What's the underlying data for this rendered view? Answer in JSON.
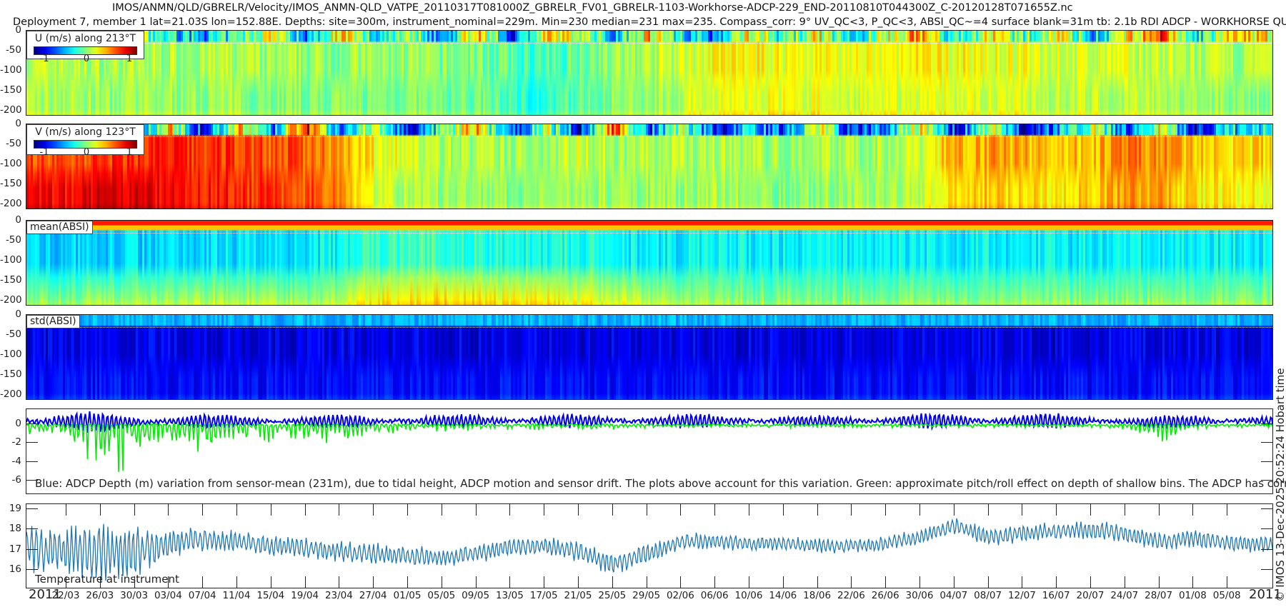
{
  "title": {
    "line1": "IMOS/ANMN/QLD/GBRELR/Velocity/IMOS_ANMN-QLD_VATPE_20110317T081000Z_GBRELR_FV01_GBRELR-1103-Workhorse-ADCP-229_END-20110810T044300Z_C-20120128T071655Z.nc",
    "line2": "Deployment 7, member 1 lat=21.03S lon=152.88E. Depths: site=300m, instrument_nominal=229m. Min=230 median=231 max=235. Compass_corr: 9° UV_QC<3, P_QC<3, ABSI_QC~=4 surface blank=31m tb: 2.1b RDI ADCP - WORKHORSE QUARTERMASTER"
  },
  "x_axis": {
    "year_left": "2011",
    "year_right": "2011",
    "ticks": [
      "22/03",
      "26/03",
      "30/03",
      "03/04",
      "07/04",
      "11/04",
      "15/04",
      "19/04",
      "23/04",
      "27/04",
      "01/05",
      "05/05",
      "09/05",
      "13/05",
      "17/05",
      "21/05",
      "25/05",
      "29/05",
      "02/06",
      "06/06",
      "10/06",
      "14/06",
      "18/06",
      "22/06",
      "26/06",
      "30/06",
      "04/07",
      "08/07",
      "12/07",
      "16/07",
      "20/07",
      "24/07",
      "28/07",
      "01/08",
      "05/08"
    ]
  },
  "footer": "© IMOS 13-Dec-2025 20:52:24 Hobart time",
  "colors": {
    "depth_series": "#0000ee",
    "pitch_roll_series": "#00ee00",
    "temperature_series": "#1f77b4",
    "colormap": "jet"
  },
  "chart_data": [
    {
      "type": "heatmap",
      "id": "u",
      "legend": "U (m/s) along 213°T",
      "colorbar_ticks": [
        "-1",
        "0",
        "1"
      ],
      "clim": [
        -1.25,
        1.25
      ],
      "ylim": [
        -214,
        0
      ],
      "ytick_labels": [
        "0",
        "-50",
        "-100",
        "-150",
        "-200"
      ],
      "surface_blank_depth": -30,
      "band_values_by_tick_date": {
        "surface": [
          0.3,
          0.2,
          0,
          -0.3,
          -0.5,
          -0.2,
          0.4,
          -0.6,
          0.5,
          -0.4,
          0.2,
          -0.7,
          0.6,
          -0.8,
          0.3,
          0.2,
          -0.5,
          0.5,
          -0.3,
          -0.6,
          0.4,
          -0.3,
          0.3,
          -0.5,
          0.2,
          0.6,
          -0.4,
          0.3,
          -0.2,
          0.4,
          -0.5,
          0.2,
          0.8,
          -0.4,
          0.3
        ],
        "upper": [
          0.15,
          0.1,
          0.1,
          0.1,
          0.1,
          0.1,
          0.05,
          0.05,
          0.05,
          0.05,
          0.05,
          0,
          0,
          -0.1,
          -0.2,
          0,
          0.05,
          0.1,
          0.2,
          0.3,
          0.3,
          0.3,
          0.3,
          0.25,
          0.25,
          0.3,
          0.3,
          0.25,
          0.25,
          0.2,
          0.2,
          0.2,
          0.15,
          0.1,
          0.1
        ],
        "lower": [
          0.1,
          0.05,
          0.05,
          0.05,
          0.05,
          0.05,
          0,
          0,
          0,
          0,
          0,
          -0.05,
          -0.05,
          -0.15,
          -0.25,
          -0.05,
          0,
          0.05,
          0.15,
          0.25,
          0.25,
          0.25,
          0.25,
          0.2,
          0.2,
          0.25,
          0.25,
          0.2,
          0.2,
          0.15,
          0.15,
          0.15,
          0.1,
          0.05,
          0.05
        ]
      }
    },
    {
      "type": "heatmap",
      "id": "v",
      "legend": "V (m/s) along 123°T",
      "colorbar_ticks": [
        "-1",
        "0",
        "1"
      ],
      "clim": [
        -1.25,
        1.25
      ],
      "ylim": [
        -214,
        0
      ],
      "ytick_labels": [
        "0",
        "-50",
        "-100",
        "-150",
        "-200"
      ],
      "surface_blank_depth": -30,
      "band_values_by_tick_date": {
        "surface": [
          -0.8,
          0.3,
          -0.9,
          0.4,
          -1,
          0.5,
          -0.7,
          1.1,
          -0.9,
          0.3,
          -1,
          -0.2,
          0.5,
          -0.9,
          0.2,
          -1,
          0.9,
          -0.8,
          0.2,
          -1,
          -0.3,
          -0.9,
          0.4,
          -1,
          -0.5,
          0.3,
          -0.9,
          0.2,
          -1,
          -0.6,
          0.2,
          -0.8,
          0.3,
          -1,
          -0.4
        ],
        "upper": [
          0.75,
          0.8,
          0.85,
          0.85,
          0.8,
          0.8,
          0.75,
          0.7,
          0.6,
          0.3,
          0.2,
          0.1,
          0.1,
          0.05,
          0.1,
          0.2,
          0.1,
          0.1,
          0.1,
          0.15,
          0.1,
          0.05,
          0.1,
          0.1,
          0.1,
          0.2,
          0.5,
          0.55,
          0.5,
          0.45,
          0.5,
          0.6,
          0.6,
          0.45,
          0.4
        ],
        "lower": [
          0.95,
          1.0,
          1.0,
          0.95,
          0.9,
          0.85,
          0.8,
          0.75,
          0.65,
          0.2,
          0.1,
          0.05,
          0.05,
          0,
          0.05,
          0.1,
          0.05,
          0.05,
          0.05,
          0.1,
          0.05,
          0,
          0.05,
          0.05,
          0.1,
          0.15,
          0.4,
          0.45,
          0.4,
          0.35,
          0.45,
          0.55,
          0.55,
          0.35,
          0.3
        ]
      }
    },
    {
      "type": "heatmap",
      "id": "mean_absi",
      "legend": "mean(ABSI)",
      "ylim": [
        -214,
        0
      ],
      "ytick_labels": [
        "0",
        "-50",
        "-100",
        "-150",
        "-200"
      ],
      "band_levels_by_tick_date": {
        "surface": [
          0.85,
          0.85,
          0.85,
          0.85,
          0.85,
          0.85,
          0.85,
          0.85,
          0.85,
          0.85,
          0.85,
          0.85,
          0.85,
          0.85,
          0.85,
          0.85,
          0.85,
          0.85,
          0.85,
          0.85,
          0.85,
          0.85,
          0.85,
          0.85,
          0.85,
          0.85,
          0.85,
          0.85,
          0.85,
          0.85,
          0.85,
          0.85,
          0.85,
          0.85,
          0.85
        ],
        "upper": [
          0.33,
          0.33,
          0.34,
          0.34,
          0.35,
          0.35,
          0.35,
          0.36,
          0.38,
          0.42,
          0.44,
          0.44,
          0.42,
          0.4,
          0.4,
          0.4,
          0.38,
          0.36,
          0.36,
          0.37,
          0.37,
          0.37,
          0.37,
          0.37,
          0.37,
          0.37,
          0.37,
          0.37,
          0.37,
          0.37,
          0.37,
          0.37,
          0.37,
          0.37,
          0.37
        ],
        "lower": [
          0.5,
          0.52,
          0.52,
          0.53,
          0.53,
          0.53,
          0.52,
          0.52,
          0.55,
          0.62,
          0.64,
          0.65,
          0.64,
          0.62,
          0.62,
          0.6,
          0.58,
          0.55,
          0.52,
          0.52,
          0.5,
          0.5,
          0.5,
          0.5,
          0.5,
          0.5,
          0.5,
          0.5,
          0.5,
          0.5,
          0.5,
          0.5,
          0.5,
          0.5,
          0.5
        ]
      }
    },
    {
      "type": "heatmap",
      "id": "std_absi",
      "legend": "std(ABSI)",
      "ylim": [
        -214,
        0
      ],
      "ytick_labels": [
        "0",
        "-50",
        "-100",
        "-150",
        "-200"
      ],
      "band_levels_by_tick_date": {
        "surface": [
          0.3,
          0.3,
          0.3,
          0.3,
          0.3,
          0.3,
          0.3,
          0.3,
          0.3,
          0.3,
          0.3,
          0.3,
          0.3,
          0.3,
          0.3,
          0.3,
          0.3,
          0.3,
          0.3,
          0.3,
          0.3,
          0.3,
          0.3,
          0.3,
          0.3,
          0.3,
          0.3,
          0.3,
          0.3,
          0.3,
          0.3,
          0.3,
          0.3,
          0.3,
          0.3
        ],
        "upper": [
          0.1,
          0.1,
          0.1,
          0.1,
          0.1,
          0.1,
          0.1,
          0.1,
          0.1,
          0.1,
          0.1,
          0.1,
          0.1,
          0.1,
          0.1,
          0.1,
          0.1,
          0.1,
          0.1,
          0.1,
          0.1,
          0.1,
          0.1,
          0.1,
          0.1,
          0.1,
          0.1,
          0.1,
          0.1,
          0.1,
          0.1,
          0.1,
          0.1,
          0.1,
          0.1
        ],
        "lower": [
          0.13,
          0.13,
          0.13,
          0.13,
          0.13,
          0.13,
          0.13,
          0.13,
          0.13,
          0.13,
          0.13,
          0.13,
          0.13,
          0.13,
          0.13,
          0.13,
          0.13,
          0.13,
          0.13,
          0.13,
          0.13,
          0.13,
          0.13,
          0.13,
          0.13,
          0.13,
          0.13,
          0.13,
          0.13,
          0.13,
          0.13,
          0.13,
          0.13,
          0.13,
          0.13
        ]
      }
    },
    {
      "type": "line",
      "id": "depth",
      "note": "Blue: ADCP Depth (m) variation from sensor-mean (231m), due to tidal height, ADCP motion and sensor drift. The plots above account for this variation. Green: approximate pitch/roll effect on depth of shallow bins. The ADCP has corrected for this.",
      "ylim": [
        -7.5,
        1.6
      ],
      "ytick_labels": [
        "0",
        "-2",
        "-4",
        "-6"
      ],
      "yticks": [
        0,
        -2,
        -4,
        -6
      ],
      "blue_mean_by_tick_date": [
        0.3,
        0.2,
        0.2,
        0.3,
        0.3,
        0.3,
        0.3,
        0.3,
        0.3,
        0.3,
        0.35,
        0.35,
        0.35,
        0.35,
        0.35,
        0.35,
        0.35,
        0.35,
        0.35,
        0.35,
        0.35,
        0.35,
        0.35,
        0.35,
        0.35,
        0.35,
        0.35,
        0.35,
        0.35,
        0.35,
        0.35,
        0.3,
        0.2,
        0.3,
        0.35
      ],
      "blue_tidal_amplitude_by_tick_date": [
        1.2,
        1.0,
        0.9,
        0.8,
        0.7,
        0.6,
        0.6,
        0.6,
        0.7,
        0.7,
        0.6,
        0.6,
        0.7,
        0.8,
        0.7,
        0.6,
        0.6,
        0.6,
        0.7,
        0.7,
        0.6,
        0.5,
        0.5,
        0.6,
        0.6,
        0.7,
        0.8,
        0.8,
        0.8,
        0.7,
        0.6,
        0.6,
        0.7,
        0.7,
        0.6
      ],
      "green_min_by_tick_date": [
        -2,
        -5.5,
        -5,
        -4.5,
        -3,
        -2,
        -2,
        -1.5,
        -2.5,
        -1,
        -0.8,
        -0.8,
        -0.6,
        -0.5,
        -0.5,
        -0.5,
        -0.6,
        -0.3,
        -0.3,
        -0.3,
        -0.3,
        -0.3,
        -0.3,
        -0.3,
        -0.3,
        -0.3,
        -0.3,
        -0.3,
        -0.3,
        -0.3,
        -0.3,
        -0.5,
        -2,
        -0.6,
        -0.3
      ]
    },
    {
      "type": "line",
      "id": "temperature",
      "label": "Temperature at instrument",
      "ylim": [
        15.05,
        19.25
      ],
      "ytick_labels": [
        "16",
        "17",
        "18",
        "19"
      ],
      "yticks": [
        16,
        17,
        18,
        19
      ],
      "mean_by_tick_date": [
        17.0,
        16.8,
        16.9,
        17.3,
        17.5,
        17.4,
        17.2,
        17.1,
        16.9,
        16.8,
        16.7,
        16.6,
        16.8,
        17.1,
        17.2,
        16.9,
        16.3,
        16.8,
        17.4,
        17.4,
        17.3,
        17.3,
        17.2,
        17.2,
        17.3,
        17.6,
        18.2,
        17.6,
        17.8,
        17.9,
        18.0,
        17.8,
        17.4,
        17.6,
        17.3
      ],
      "amplitude_by_tick_date": [
        1.3,
        1.6,
        1.4,
        0.9,
        0.7,
        0.6,
        0.6,
        0.6,
        0.6,
        0.6,
        0.6,
        0.5,
        0.5,
        0.5,
        0.5,
        0.6,
        0.6,
        0.6,
        0.5,
        0.5,
        0.4,
        0.4,
        0.4,
        0.4,
        0.4,
        0.5,
        0.5,
        0.5,
        0.5,
        0.5,
        0.5,
        0.5,
        0.5,
        0.5,
        0.5
      ]
    }
  ]
}
